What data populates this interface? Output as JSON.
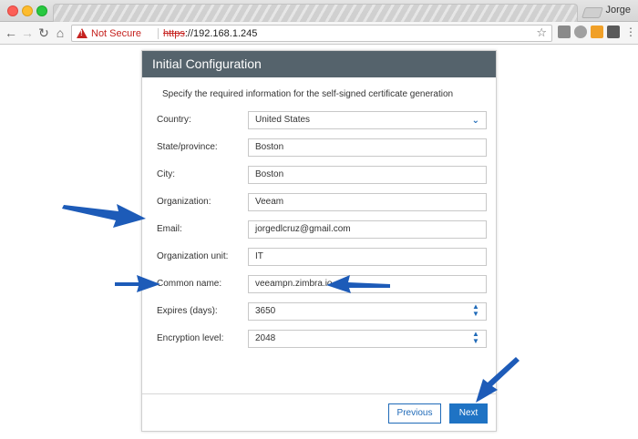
{
  "browser": {
    "profile_name": "Jorge",
    "security_label": "Not Secure",
    "url_scheme": "https",
    "url_rest": "://192.168.1.245",
    "menu_glyph": "⋮"
  },
  "dialog": {
    "title": "Initial Configuration",
    "subtitle": "Specify the required information for the self-signed certificate generation",
    "fields": [
      {
        "label": "Country:",
        "value": "United States",
        "kind": "select"
      },
      {
        "label": "State/province:",
        "value": "Boston",
        "kind": "text"
      },
      {
        "label": "City:",
        "value": "Boston",
        "kind": "text"
      },
      {
        "label": "Organization:",
        "value": "Veeam",
        "kind": "text"
      },
      {
        "label": "Email:",
        "value": "jorgedlcruz@gmail.com",
        "kind": "text"
      },
      {
        "label": "Organization unit:",
        "value": "IT",
        "kind": "text"
      },
      {
        "label": "Common name:",
        "value": "veeampn.zimbra.io",
        "kind": "text"
      },
      {
        "label": "Expires (days):",
        "value": "3650",
        "kind": "spinner"
      },
      {
        "label": "Encryption level:",
        "value": "2048",
        "kind": "spinner"
      }
    ],
    "buttons": {
      "previous": "Previous",
      "next": "Next"
    }
  },
  "colors": {
    "header": "#55636c",
    "accent": "#1f73c4",
    "arrow": "#1d5bb8",
    "warning": "#c5221f"
  }
}
